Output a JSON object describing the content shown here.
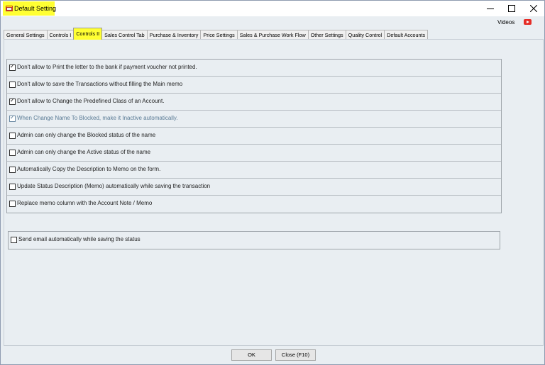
{
  "window": {
    "title": "Default Setting",
    "controls": {
      "minimize": "—",
      "maximize": "☐",
      "close": "✕"
    }
  },
  "header": {
    "videos_label": "Videos",
    "video_icon": "youtube-icon"
  },
  "tabs": [
    {
      "label": "General Settings"
    },
    {
      "label": "Controls I"
    },
    {
      "label": "Controls II",
      "active": true
    },
    {
      "label": "Sales Control Tab"
    },
    {
      "label": "Purchase & Inventory"
    },
    {
      "label": "Price Settings"
    },
    {
      "label": "Sales & Purchase Work Flow"
    },
    {
      "label": "Other Settings"
    },
    {
      "label": "Quality Control"
    },
    {
      "label": "Default Accounts"
    }
  ],
  "options": [
    {
      "label": "Don't allow to Print the letter to the bank if payment voucher not printed.",
      "checked": true
    },
    {
      "label": "Don't allow to save the Transactions without filling the Main memo",
      "checked": false
    },
    {
      "label": "Don't allow to Change the Predefined Class of an Account.",
      "checked": true
    },
    {
      "label": "When Change Name To Blocked, make it Inactive automatically.",
      "checked": true,
      "disabled": true
    },
    {
      "label": "Admin can only change the Blocked status of the name",
      "checked": false
    },
    {
      "label": "Admin can only change the Active status of the name",
      "checked": false
    },
    {
      "label": "Automatically Copy the Description to Memo on the form.",
      "checked": false
    },
    {
      "label": "Update Status Description (Memo) automatically while saving the transaction",
      "checked": false
    },
    {
      "label": "Replace memo column with the Account Note / Memo",
      "checked": false
    }
  ],
  "email_option": {
    "label": "Send email automatically while saving the status",
    "checked": false
  },
  "footer": {
    "ok_label": "OK",
    "close_label": "Close (F10)"
  },
  "colors": {
    "highlight": "#ffff33",
    "youtube": "#e52d27",
    "background": "#e9eef2"
  }
}
